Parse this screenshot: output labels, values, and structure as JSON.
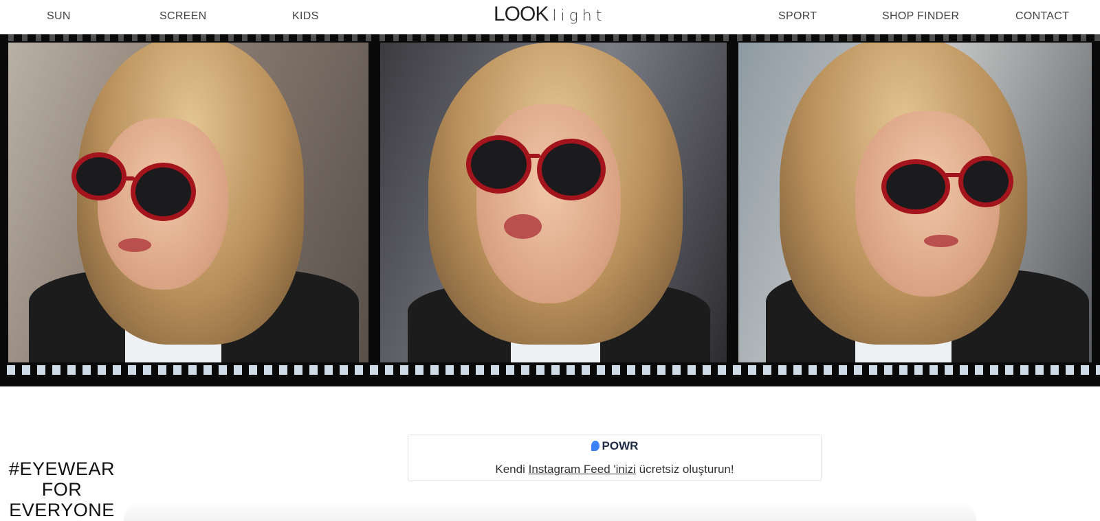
{
  "nav": {
    "left": [
      "SUN",
      "SCREEN",
      "KIDS"
    ],
    "right": [
      "SPORT",
      "SHOP FINDER",
      "CONTACT"
    ]
  },
  "logo": {
    "main": "LOOK",
    "sub": "light"
  },
  "powr": {
    "brand": "POWR",
    "text_before": "Kendi ",
    "link_text": "Instagram Feed 'inizi",
    "text_after": " ücretsiz oluşturun!"
  },
  "tagline": [
    "#EYEWEAR",
    "FOR",
    "EVERYONE"
  ],
  "colors": {
    "frame_red": "#a3141c",
    "powr_blue": "#3b82f6",
    "film_black": "#0a0a0a"
  }
}
